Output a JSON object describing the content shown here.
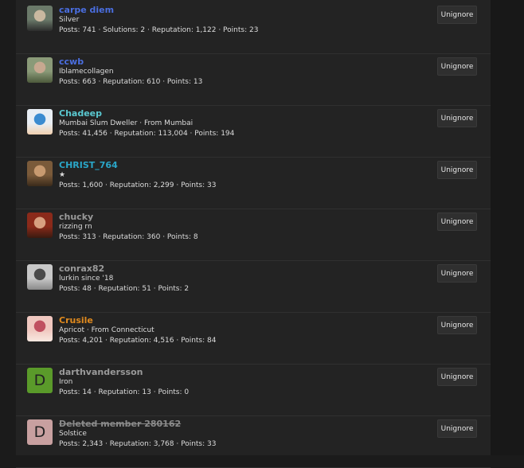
{
  "button_label": "Unignore",
  "members": [
    {
      "name": "carpe diem",
      "name_color": "#4a6ee0",
      "strike": false,
      "title": "Silver",
      "stats": "Posts: 741 · Solutions: 2 · Reputation: 1,122 · Points: 23",
      "avatar": "photo",
      "avatar_colors": [
        "#6b7a6a",
        "#c9b8a0",
        "#2c2c2c"
      ]
    },
    {
      "name": "ccwb",
      "name_color": "#4a6ee0",
      "strike": false,
      "title": "Iblamecollagen",
      "stats": "Posts: 663 · Reputation: 610 · Points: 13",
      "avatar": "photo",
      "avatar_colors": [
        "#8a9a78",
        "#c7a890",
        "#4d5a3c"
      ]
    },
    {
      "name": "Chadeep",
      "name_color": "#5ac8d0",
      "strike": false,
      "title": "Mumbai Slum Dweller · From Mumbai",
      "stats": "Posts: 41,456 · Reputation: 113,004 · Points: 194",
      "avatar": "photo",
      "avatar_colors": [
        "#e8eef4",
        "#3a8bd0",
        "#f0d0b0"
      ]
    },
    {
      "name": "CHRIST_764",
      "name_color": "#2aa6c8",
      "strike": false,
      "title": "★",
      "stats": "Posts: 1,600 · Reputation: 2,299 · Points: 33",
      "avatar": "photo",
      "avatar_colors": [
        "#7a5a3a",
        "#c89a70",
        "#3a2a1a"
      ]
    },
    {
      "name": "chucky",
      "name_color": "#9a9a9a",
      "strike": false,
      "title": "rizzing rn",
      "stats": "Posts: 313 · Reputation: 360 · Points: 8",
      "avatar": "photo",
      "avatar_colors": [
        "#8a2a1a",
        "#d8a080",
        "#3a1a10"
      ]
    },
    {
      "name": "conrax82",
      "name_color": "#9a9a9a",
      "strike": false,
      "title": "lurkin since '18",
      "stats": "Posts: 48 · Reputation: 51 · Points: 2",
      "avatar": "photo",
      "avatar_colors": [
        "#c8c8c8",
        "#4a4a4a",
        "#8a8a8a"
      ]
    },
    {
      "name": "Crusile",
      "name_color": "#e08a1e",
      "strike": false,
      "title": "Apricot · From Connecticut",
      "stats": "Posts: 4,201 · Reputation: 4,516 · Points: 84",
      "avatar": "photo",
      "avatar_colors": [
        "#f0c8c0",
        "#c05060",
        "#f8e8e0"
      ]
    },
    {
      "name": "darthvandersson",
      "name_color": "#9a9a9a",
      "strike": false,
      "title": "Iron",
      "stats": "Posts: 14 · Reputation: 13 · Points: 0",
      "avatar": "letter",
      "letter": "D",
      "avatar_colors": [
        "#5a9a2a"
      ]
    },
    {
      "name": "Deleted member 280162",
      "name_color": "#8a8a8a",
      "strike": true,
      "title": "Solstice",
      "stats": "Posts: 2,343 · Reputation: 3,768 · Points: 33",
      "avatar": "letter",
      "letter": "D",
      "avatar_colors": [
        "#c8a0a0"
      ]
    }
  ]
}
